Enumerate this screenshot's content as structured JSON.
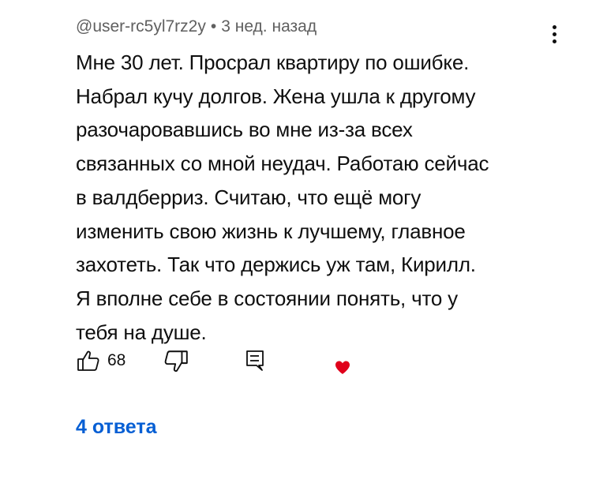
{
  "comment": {
    "author": "@user-rc5yl7rz2y",
    "separator": "•",
    "time": "3 нед. назад",
    "lines": [
      "Мне 30 лет. Просрал квартиру по ошибке.",
      "Набрал кучу долгов. Жена ушла к другому",
      "разочаровавшись во мне из-за всех",
      "связанных со мной неудач. Работаю сейчас",
      "в валдберриз. Считаю, что ещё могу",
      "изменить свою жизнь к лучшему, главное",
      "захотеть. Так что держись уж там, Кирилл.",
      "Я вполне себе в состоянии понять, что у",
      "тебя на душе."
    ]
  },
  "actions": {
    "like_icon": "thumb-up-icon",
    "like_count": "68",
    "dislike_icon": "thumb-down-icon",
    "reply_icon": "comment-reply-icon",
    "heart_icon": "creator-heart-icon",
    "heart_color": "#e0001b"
  },
  "replies": {
    "label": "4 ответа",
    "color": "#065fd4"
  },
  "menu": {
    "icon": "more-vertical-icon"
  }
}
